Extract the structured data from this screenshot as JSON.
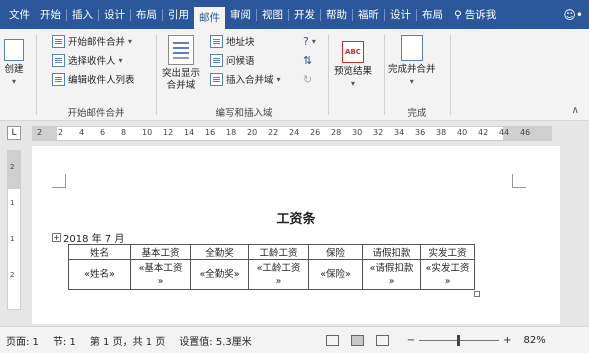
{
  "tabs": [
    "文件",
    "开始",
    "插入",
    "设计",
    "布局",
    "引用",
    "邮件",
    "审阅",
    "视图",
    "开发",
    "帮助",
    "福昕",
    "设计",
    "布局"
  ],
  "active_tab_index": 6,
  "tell_me": "告诉我",
  "ribbon": {
    "create": {
      "label": "创建"
    },
    "start_merge": {
      "items": [
        "开始邮件合并",
        "选择收件人",
        "编辑收件人列表"
      ],
      "group_label": "开始邮件合并"
    },
    "write_insert": {
      "highlight": "突出显示\n合并域",
      "items": [
        "地址块",
        "问候语",
        "插入合并域"
      ],
      "group_label": "编写和插入域"
    },
    "preview": {
      "label": "预览结果",
      "icon_text": "ABC"
    },
    "finish": {
      "label": "完成并合并",
      "group_label": "完成"
    }
  },
  "ruler_numbers": [
    "2",
    "2",
    "4",
    "6",
    "8",
    "10",
    "12",
    "14",
    "16",
    "18",
    "20",
    "22",
    "24",
    "26",
    "28",
    "30",
    "32",
    "34",
    "36",
    "38",
    "40",
    "42",
    "44",
    "46"
  ],
  "vruler_numbers": [
    "2",
    "1",
    "1",
    "2"
  ],
  "document": {
    "title": "工资条",
    "date": "2018 年 7 月",
    "table": {
      "headers": [
        "姓名",
        "基本工资",
        "全勤奖",
        "工龄工资",
        "保险",
        "请假扣款",
        "实发工资"
      ],
      "row": [
        "«姓名»",
        "«基本工资\n»",
        "«全勤奖»",
        "«工龄工资\n»",
        "«保险»",
        "«请假扣款\n»",
        "«实发工资\n»"
      ]
    }
  },
  "status": {
    "page": "页面: 1",
    "section": "节: 1",
    "pages": "第 1 页，共 1 页",
    "setting": "设置值: 5.3厘米",
    "zoom_minus": "−",
    "zoom_plus": "+",
    "zoom": "82%"
  },
  "colors": {
    "accent": "#2b579a"
  }
}
